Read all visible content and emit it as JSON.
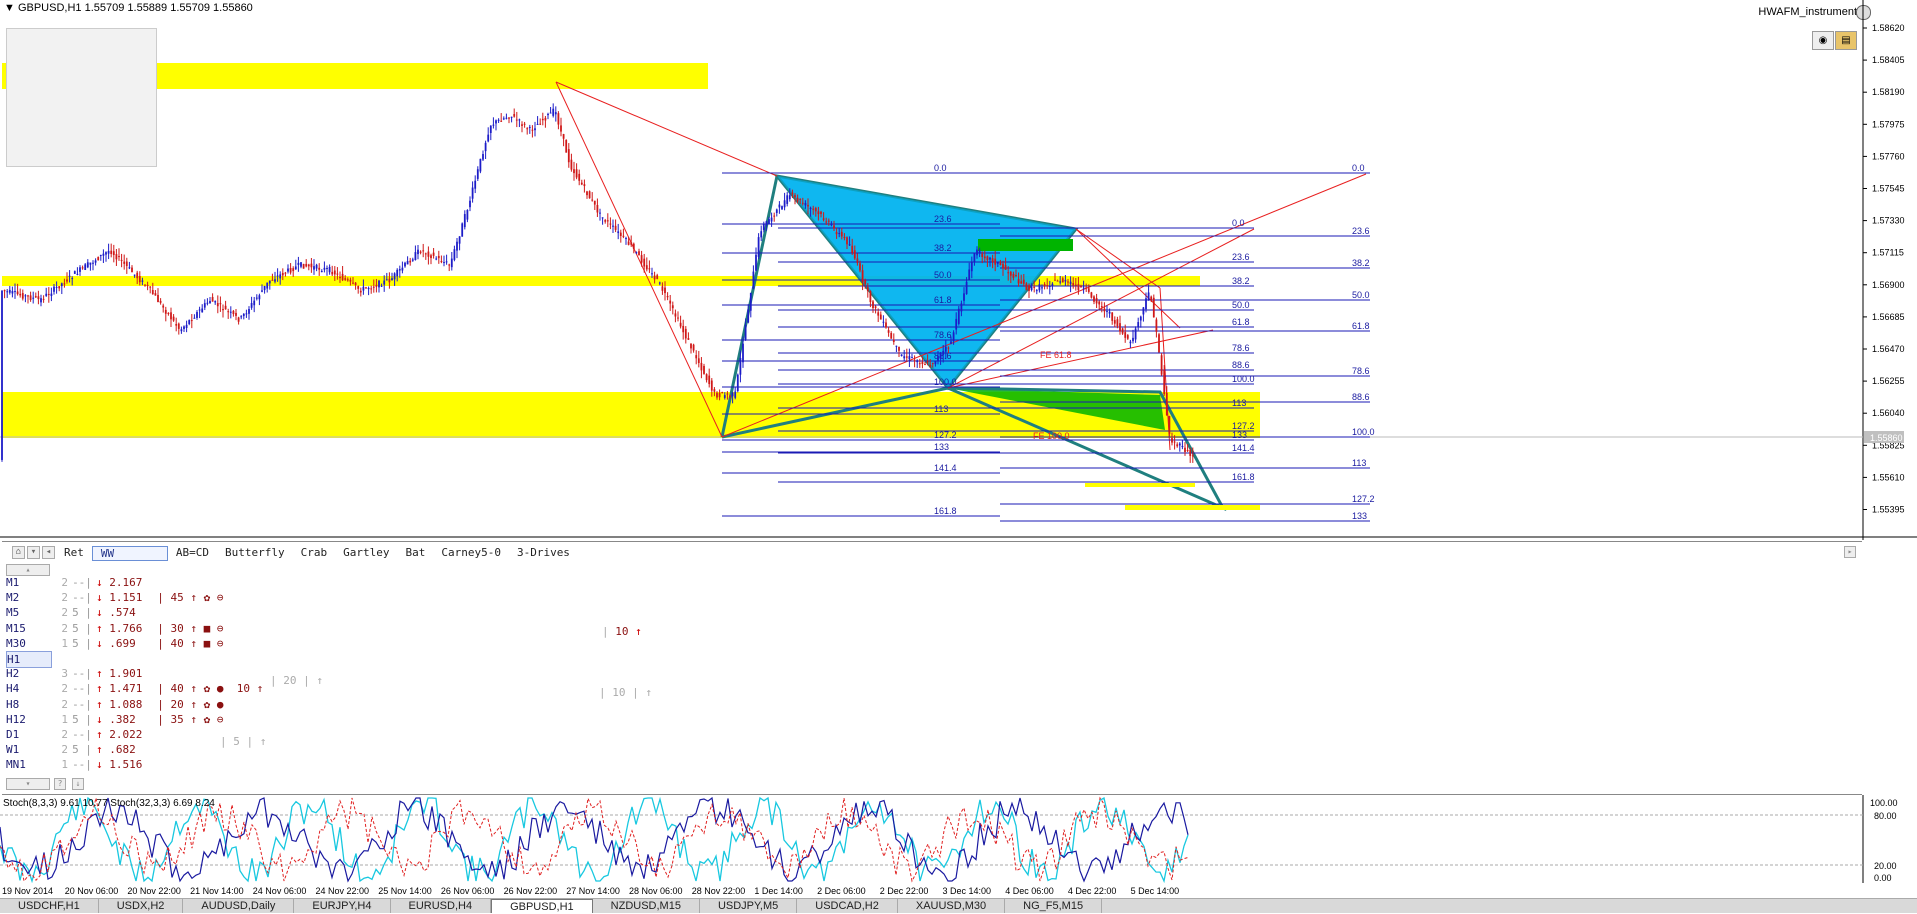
{
  "window": {
    "title": "GBPUSD,H1  1.55709 1.55889 1.55709 1.55860",
    "instrument_label": "HWAFM_instrument"
  },
  "chart_data": {
    "type": "candlestick",
    "symbol": "GBPUSD",
    "timeframe": "H1",
    "ylim": [
      1.553,
      1.587
    ],
    "y_ticks": [
      "1.58620",
      "1.58405",
      "1.58190",
      "1.57975",
      "1.57760",
      "1.57545",
      "1.57330",
      "1.57115",
      "1.56900",
      "1.56685",
      "1.56470",
      "1.56255",
      "1.56040",
      "1.55825",
      "1.55610",
      "1.55395"
    ],
    "current_price": "1.55860",
    "x_ticks": [
      "19 Nov 2014",
      "20 Nov 06:00",
      "20 Nov 22:00",
      "21 Nov 14:00",
      "24 Nov 06:00",
      "24 Nov 22:00",
      "25 Nov 14:00",
      "26 Nov 06:00",
      "26 Nov 22:00",
      "27 Nov 14:00",
      "28 Nov 06:00",
      "28 Nov 22:00",
      "1 Dec 14:00",
      "2 Dec 06:00",
      "2 Dec 22:00",
      "3 Dec 14:00",
      "4 Dec 06:00",
      "4 Dec 22:00",
      "5 Dec 14:00"
    ],
    "fib_left_levels": [
      "0.0",
      "23.6",
      "38.2",
      "50.0",
      "61.8",
      "78.6",
      "88.6",
      "100.0",
      "113",
      "127.2",
      "133",
      "141.4",
      "161.8"
    ],
    "fib_right_levels": [
      "0.0",
      "23.6",
      "38.2",
      "50.0",
      "61.8",
      "78.6",
      "88.6",
      "100.0",
      "113",
      "127.2",
      "133"
    ],
    "fib_mid_levels": [
      "0.0",
      "23.6",
      "38.2",
      "50.0",
      "61.8",
      "78.6",
      "88.6",
      "100.0",
      "113",
      "127.2",
      "133",
      "141.4",
      "161.8"
    ],
    "fe_labels": [
      "FE 61.8",
      "FE 100.0"
    ],
    "colors": {
      "bull": "#1c1cc8",
      "bear": "#d01818",
      "zone": "#ffff00",
      "pattern": "#00aaee",
      "pattern_edge": "#1f7f7f",
      "trend": "#e82020",
      "green": "#00b400"
    }
  },
  "panel": {
    "tabs": [
      "Ret",
      "WW",
      "AB=CD",
      "Butterfly",
      "Crab",
      "Gartley",
      "Bat",
      "Carney5-0",
      "3-Drives"
    ],
    "active_tab": "WW",
    "rows": [
      {
        "tf": "M1",
        "a": "2",
        "b": "--|",
        "dir": "↓",
        "val": "2.167",
        "x": "",
        "y": ""
      },
      {
        "tf": "M2",
        "a": "2",
        "b": "--|",
        "dir": "↓",
        "val": "1.151",
        "x": "45",
        "y": "↑ ✿ ⊖"
      },
      {
        "tf": "M5",
        "a": "2",
        "b": "5 |",
        "dir": "↓",
        "val": ".574",
        "x": "",
        "y": ""
      },
      {
        "tf": "M15",
        "a": "2",
        "b": "5 |",
        "dir": "↑",
        "val": "1.766",
        "x": "30",
        "y": "↑ ■ ⊖"
      },
      {
        "tf": "M30",
        "a": "1",
        "b": "5 |",
        "dir": "↓",
        "val": ".699",
        "x": "40",
        "y": "↑ ■ ⊖"
      },
      {
        "tf": "H1",
        "a": "",
        "b": "",
        "dir": "",
        "val": "",
        "x": "",
        "y": ""
      },
      {
        "tf": "H2",
        "a": "3",
        "b": "--|",
        "dir": "↑",
        "val": "1.901",
        "x": "",
        "y": ""
      },
      {
        "tf": "H4",
        "a": "2",
        "b": "--|",
        "dir": "↑",
        "val": "1.471",
        "x": "40",
        "y": "↑ ✿ ●  10 ↑"
      },
      {
        "tf": "H8",
        "a": "2",
        "b": "--|",
        "dir": "↑",
        "val": "1.088",
        "x": "20",
        "y": "↑ ✿ ●"
      },
      {
        "tf": "H12",
        "a": "1",
        "b": "5 |",
        "dir": "↓",
        "val": ".382",
        "x": "35",
        "y": "↑ ✿ ⊖"
      },
      {
        "tf": "D1",
        "a": "2",
        "b": "--|",
        "dir": "↑",
        "val": "2.022",
        "x": "",
        "y": ""
      },
      {
        "tf": "W1",
        "a": "2",
        "b": "5 |",
        "dir": "↑",
        "val": ".682",
        "x": "",
        "y": ""
      },
      {
        "tf": "MN1",
        "a": "1",
        "b": "--|",
        "dir": "↓",
        "val": "1.516",
        "x": "",
        "y": ""
      }
    ],
    "extras": {
      "m15_far": "10",
      "h2_mid": "20",
      "h4_far": "10",
      "d1_mid": "5"
    }
  },
  "indicator": {
    "label": "Stoch(8,3,3) 9.61 10.77 Stoch(32,3,3) 6.69 8.24",
    "levels": [
      "100.00",
      "80.00",
      "20.00",
      "0.00"
    ]
  },
  "tabs": [
    "USDCHF,H1",
    "USDX,H2",
    "AUDUSD,Daily",
    "EURJPY,H4",
    "EURUSD,H4",
    "GBPUSD,H1",
    "NZDUSD,M15",
    "USDJPY,M5",
    "USDCAD,H2",
    "XAUUSD,M30",
    "NG_F5,M15"
  ],
  "active_tab": "GBPUSD,H1"
}
